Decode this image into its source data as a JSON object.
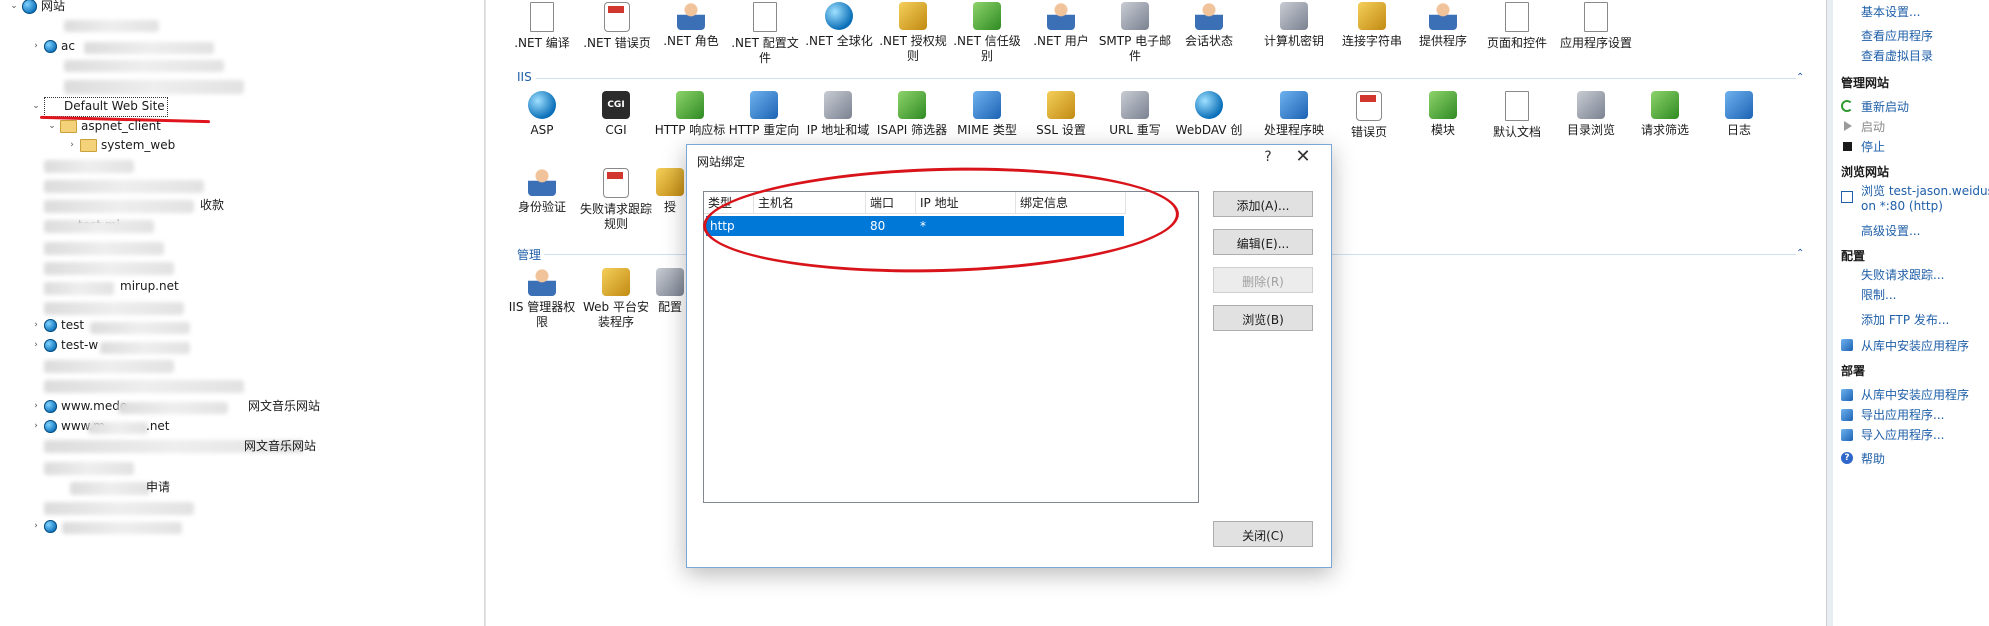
{
  "tree": {
    "root_label": "网站",
    "default_site": "Default Web Site",
    "aspnet_client": "aspnet_client",
    "system_web": "system_web",
    "partials": [
      "ac",
      "test",
      "test-w",
      "www.mede",
      "www.m",
      "mirup.net",
      "test.mi",
      "收款",
      "网文音乐网站",
      "网文音乐网站",
      "申请",
      ".net"
    ]
  },
  "center": {
    "top_row": [
      ".NET 编译",
      ".NET 错误页",
      ".NET 角色",
      ".NET 配置文件",
      ".NET 全球化",
      ".NET 授权规则",
      ".NET 信任级别",
      ".NET 用户",
      "SMTP 电子邮件",
      "会话状态",
      "计算机密钥",
      "连接字符串",
      "提供程序",
      "页面和控件",
      "应用程序设置"
    ],
    "iis_section": "IIS",
    "iis_row1": [
      "ASP",
      "CGI",
      "HTTP 响应标",
      "HTTP 重定向",
      "IP 地址和域",
      "ISAPI 筛选器",
      "MIME 类型",
      "SSL 设置",
      "URL 重写",
      "WebDAV 创",
      "处理程序映",
      "错误页",
      "模块",
      "默认文档",
      "目录浏览",
      "请求筛选",
      "日志"
    ],
    "iis_row2": [
      "身份验证",
      "失败请求跟踪规则",
      "授"
    ],
    "cgi_icon": "CGI",
    "error404_icon": "404",
    "mgmt_section": "管理",
    "mgmt_row": [
      "IIS 管理器权限",
      "Web 平台安装程序",
      "配置"
    ]
  },
  "dialog": {
    "title": "网站绑定",
    "help": "?",
    "close": "✕",
    "columns": [
      "类型",
      "主机名",
      "端口",
      "IP 地址",
      "绑定信息"
    ],
    "row": {
      "type": "http",
      "host": "",
      "port": "80",
      "ip": "*",
      "info": ""
    },
    "buttons": {
      "add": "添加(A)...",
      "edit": "编辑(E)...",
      "remove": "删除(R)",
      "browse": "浏览(B)",
      "close": "关闭(C)"
    }
  },
  "actions": {
    "top_links": [
      "基本设置...",
      "查看应用程序",
      "查看虚拟目录"
    ],
    "manage_site": "管理网站",
    "restart": "重新启动",
    "start": "启动",
    "stop": "停止",
    "browse_head": "浏览网站",
    "browse_link1": "浏览 test-jason.weidus",
    "browse_link2": "on *:80 (http)",
    "advanced": "高级设置...",
    "config_head": "配置",
    "config_links": [
      "失败请求跟踪...",
      "限制..."
    ],
    "add_ftp": "添加 FTP 发布...",
    "install_app": "从库中安装应用程序",
    "deploy_head": "部署",
    "deploy_links": [
      "从库中安装应用程序",
      "导出应用程序...",
      "导入应用程序..."
    ],
    "help": "帮助"
  },
  "colors": {
    "accent": "#0078d7",
    "link": "#1f5fa8",
    "annotation": "#d8141a"
  }
}
